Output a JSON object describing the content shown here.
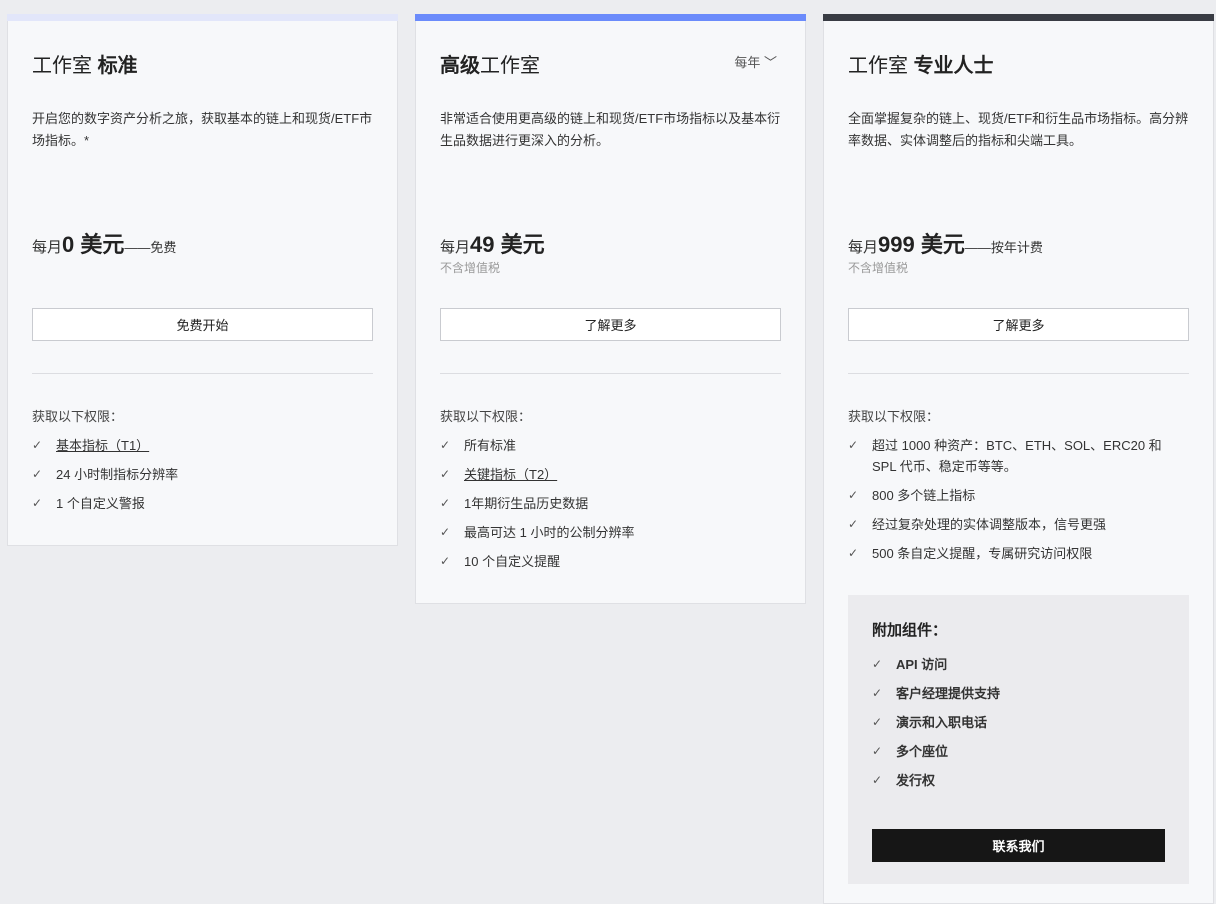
{
  "plans": [
    {
      "title_light": "工作室 ",
      "title_bold": "标准",
      "desc": "开启您的数字资产分析之旅，获取基本的链上和现货/ETF市场指标。*",
      "price_prefix": "每月",
      "price_amount": "0 美元",
      "price_suffix": "——免费",
      "button": "免费开始",
      "features_label": "获取以下权限：",
      "features": [
        "基本指标（T1）",
        "24 小时制指标分辨率",
        "1 个自定义警报"
      ]
    },
    {
      "title_bold": "高级",
      "title_light": "工作室",
      "period": "每年",
      "desc": "非常适合使用更高级的链上和现货/ETF市场指标以及基本衍生品数据进行更深入的分析。",
      "price_prefix": "每月",
      "price_amount": "49 美元",
      "tax": "不含增值税",
      "button": "了解更多",
      "features_label": "获取以下权限：",
      "features": [
        "所有标准",
        "关键指标（T2）",
        "1年期衍生品历史数据",
        "最高可达 1 小时的公制分辨率",
        "10 个自定义提醒"
      ]
    },
    {
      "title_light": "工作室 ",
      "title_bold": "专业人士",
      "desc": "全面掌握复杂的链上、现货/ETF和衍生品市场指标。高分辨率数据、实体调整后的指标和尖端工具。",
      "price_prefix": "每月",
      "price_amount": "999 美元",
      "price_suffix": "——按年计费",
      "tax": "不含增值税",
      "button": "了解更多",
      "features_label": "获取以下权限：",
      "features": [
        "超过 1000 种资产：BTC、ETH、SOL、ERC20 和 SPL 代币、稳定币等等。",
        "800 多个链上指标",
        "经过复杂处理的实体调整版本，信号更强",
        "500 条自定义提醒，专属研究访问权限"
      ],
      "addons": {
        "title": "附加组件：",
        "items": [
          "API 访问",
          "客户经理提供支持",
          "演示和入职电话",
          "多个座位",
          "发行权"
        ],
        "button": "联系我们"
      }
    }
  ],
  "check_icon": "✓"
}
